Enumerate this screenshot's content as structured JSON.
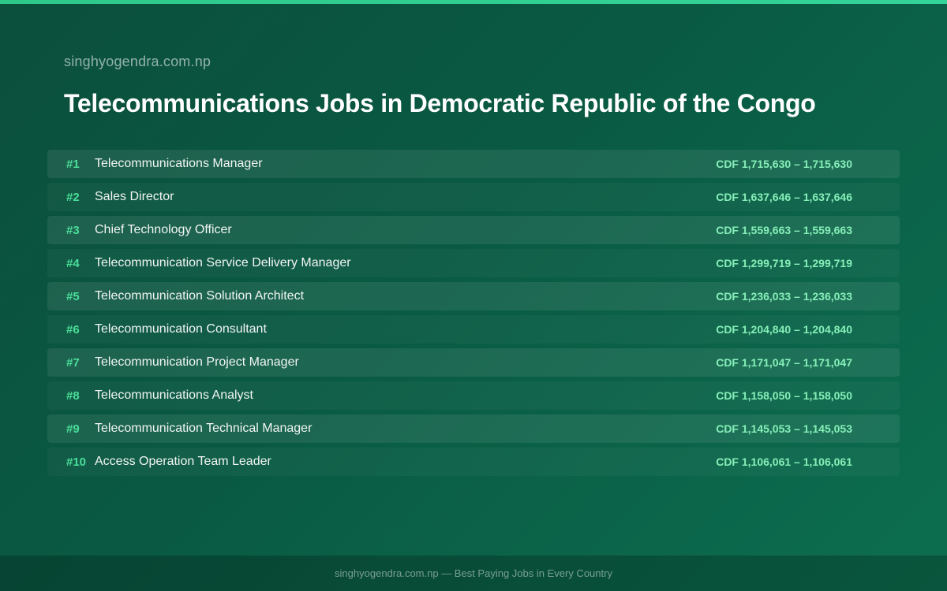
{
  "header": {
    "site_name": "singhyogendra.com.np",
    "title": "Telecommunications Jobs in Democratic Republic of the Congo"
  },
  "jobs": [
    {
      "rank": "#1",
      "title": "Telecommunications Manager",
      "salary": "CDF 1,715,630 – 1,715,630"
    },
    {
      "rank": "#2",
      "title": "Sales Director",
      "salary": "CDF 1,637,646 – 1,637,646"
    },
    {
      "rank": "#3",
      "title": "Chief Technology Officer",
      "salary": "CDF 1,559,663 – 1,559,663"
    },
    {
      "rank": "#4",
      "title": "Telecommunication Service Delivery Manager",
      "salary": "CDF 1,299,719 – 1,299,719"
    },
    {
      "rank": "#5",
      "title": "Telecommunication Solution Architect",
      "salary": "CDF 1,236,033 – 1,236,033"
    },
    {
      "rank": "#6",
      "title": "Telecommunication Consultant",
      "salary": "CDF 1,204,840 – 1,204,840"
    },
    {
      "rank": "#7",
      "title": "Telecommunication Project Manager",
      "salary": "CDF 1,171,047 – 1,171,047"
    },
    {
      "rank": "#8",
      "title": "Telecommunications Analyst",
      "salary": "CDF 1,158,050 – 1,158,050"
    },
    {
      "rank": "#9",
      "title": "Telecommunication Technical Manager",
      "salary": "CDF 1,145,053 – 1,145,053"
    },
    {
      "rank": "#10",
      "title": "Access Operation Team Leader",
      "salary": "CDF 1,106,061 – 1,106,061"
    }
  ],
  "footer": {
    "text": "singhyogendra.com.np — Best Paying Jobs in Every Country"
  },
  "colors": {
    "background_start": "#0b4f3c",
    "background_end": "#0c6e4f",
    "accent": "#34d399",
    "rank": "#4ade9a",
    "salary": "#86efb8"
  }
}
